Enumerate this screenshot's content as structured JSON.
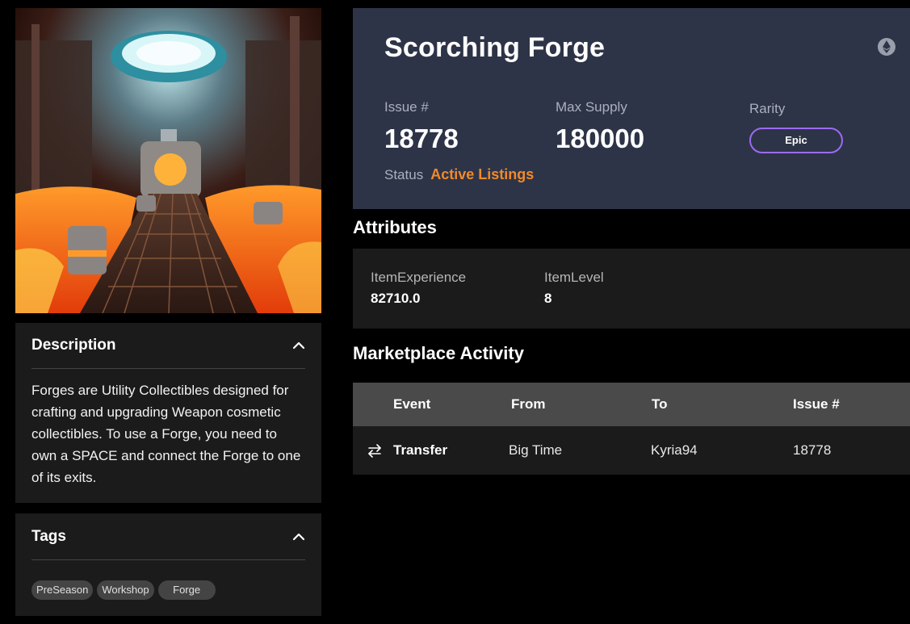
{
  "item": {
    "title": "Scorching Forge",
    "chain_icon": "ethereum-icon",
    "issue_label": "Issue #",
    "issue_value": "18778",
    "max_supply_label": "Max Supply",
    "max_supply_value": "180000",
    "rarity_label": "Rarity",
    "rarity_value": "Epic",
    "status_label": "Status",
    "status_value": "Active Listings"
  },
  "colors": {
    "hero_bg": "#2e3447",
    "accent_orange": "#f08a2a",
    "rarity_purple": "#9b6bf2",
    "panel_bg": "#1b1b1b",
    "table_header_bg": "#4a4a4a"
  },
  "description": {
    "title": "Description",
    "text": "Forges are Utility Collectibles designed for crafting and upgrading Weapon cosmetic collectibles. To use a Forge, you need to own a SPACE and connect the Forge to one of its exits."
  },
  "tags": {
    "title": "Tags",
    "items": [
      "PreSeason",
      "Workshop",
      "Forge"
    ]
  },
  "attributes": {
    "title": "Attributes",
    "items": [
      {
        "name": "ItemExperience",
        "value": "82710.0"
      },
      {
        "name": "ItemLevel",
        "value": "8"
      }
    ]
  },
  "marketplace": {
    "title": "Marketplace Activity",
    "columns": [
      "Event",
      "From",
      "To",
      "Issue #"
    ],
    "rows": [
      {
        "event": "Transfer",
        "event_icon": "swap-arrows-icon",
        "from": "Big Time",
        "to": "Kyria94",
        "issue": "18778"
      }
    ]
  }
}
